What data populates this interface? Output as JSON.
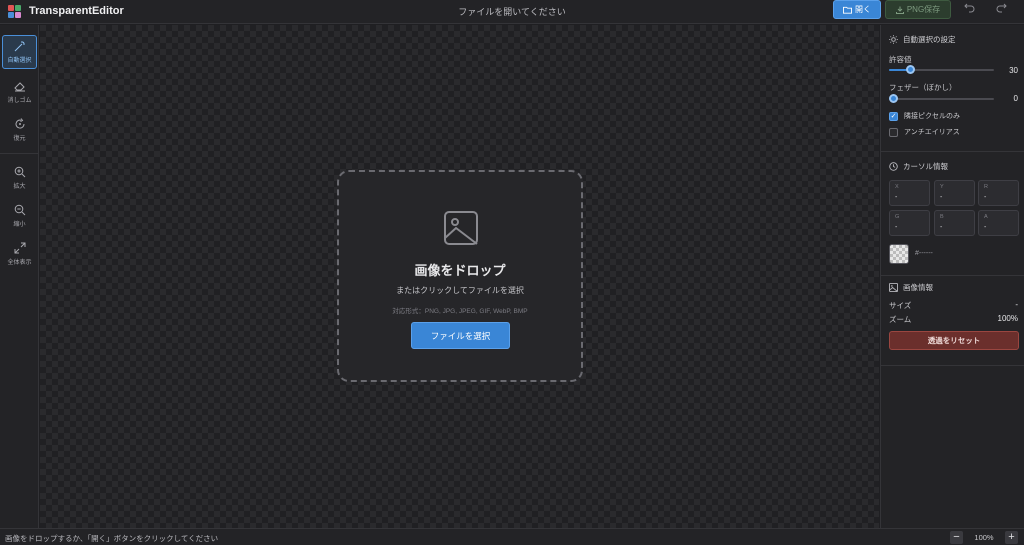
{
  "app": {
    "title": "TransparentEditor",
    "logo_colors": [
      "#e25555",
      "#4aa86a",
      "#4a8fd8",
      "#d88ad0"
    ]
  },
  "header": {
    "document_title": "ファイルを開いてください",
    "open_label": "開く",
    "save_label": "PNG保存",
    "undo_icon": "undo-icon",
    "redo_icon": "redo-icon"
  },
  "tools": [
    {
      "label": "自動選択",
      "icon": "magic-wand-icon",
      "active": true
    },
    {
      "label": "消しゴム",
      "icon": "eraser-icon",
      "active": false
    },
    {
      "label": "復元",
      "icon": "restore-icon",
      "active": false
    },
    {
      "label": "拡大",
      "icon": "zoom-in-icon",
      "active": false
    },
    {
      "label": "縮小",
      "icon": "zoom-out-icon",
      "active": false
    },
    {
      "label": "全体表示",
      "icon": "fit-view-icon",
      "active": false
    }
  ],
  "dropzone": {
    "title": "画像をドロップ",
    "subtitle": "またはクリックしてファイルを選択",
    "formats": "対応形式：PNG, JPG, JPEG, GIF, WebP, BMP",
    "button": "ファイルを選択"
  },
  "auto_select": {
    "heading": "自動選択の設定",
    "tolerance_label": "許容値",
    "tolerance_value": "30",
    "tolerance_fraction": 0.2,
    "feather_label": "フェザー（ぼかし）",
    "feather_value": "0",
    "feather_fraction": 0.0,
    "contiguous_label": "隣接ピクセルのみ",
    "contiguous_checked": true,
    "antialias_label": "アンチエイリアス",
    "antialias_checked": false
  },
  "cursor_info": {
    "heading": "カーソル情報",
    "cells": [
      {
        "label": "X",
        "value": "-"
      },
      {
        "label": "Y",
        "value": "-"
      },
      {
        "label": "R",
        "value": "-"
      },
      {
        "label": "G",
        "value": "-"
      },
      {
        "label": "B",
        "value": "-"
      },
      {
        "label": "A",
        "value": "-"
      }
    ],
    "hex": "#------"
  },
  "image_info": {
    "heading": "画像情報",
    "size_label": "サイズ",
    "size_value": "-",
    "zoom_label": "ズーム",
    "zoom_value": "100%",
    "reset_button": "透過をリセット"
  },
  "statusbar": {
    "message": "画像をドロップするか、「開く」ボタンをクリックしてください",
    "zoom_out": "−",
    "zoom_level": "100%",
    "zoom_in": "+"
  },
  "colors": {
    "accent": "#3a86d6",
    "danger": "#6b2f2c",
    "background": "#1f1f22"
  }
}
